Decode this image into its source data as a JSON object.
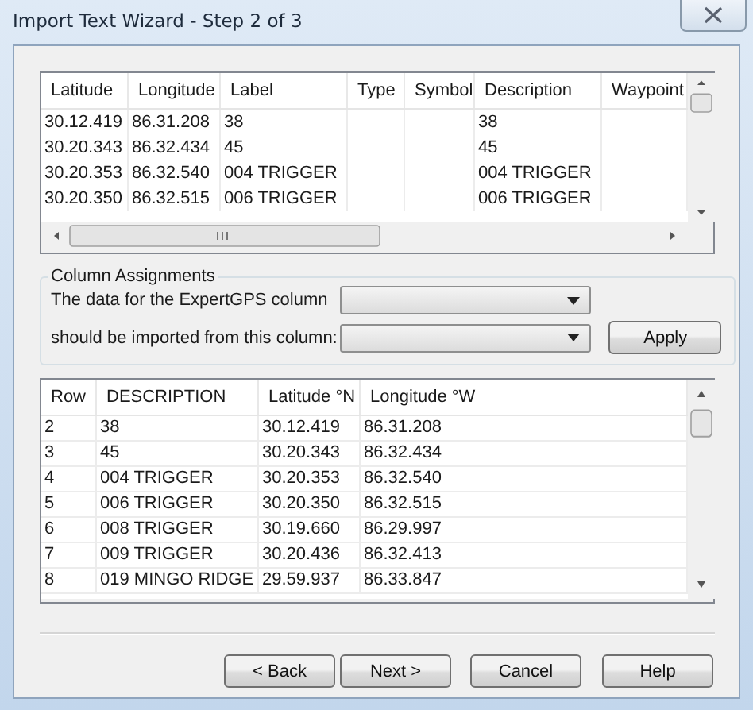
{
  "window": {
    "title": "Import Text Wizard - Step 2 of 3"
  },
  "preview_table": {
    "columns": [
      "Latitude",
      "Longitude",
      "Label",
      "Type",
      "Symbol",
      "Description",
      "Waypoint"
    ],
    "rows": [
      {
        "latitude": "30.12.419",
        "longitude": "86.31.208",
        "label": "38",
        "description": "38"
      },
      {
        "latitude": "30.20.343",
        "longitude": "86.32.434",
        "label": "45",
        "description": "45"
      },
      {
        "latitude": "30.20.353",
        "longitude": "86.32.540",
        "label": "004 TRIGGER",
        "description": "004 TRIGGER"
      },
      {
        "latitude": "30.20.350",
        "longitude": "86.32.515",
        "label": "006 TRIGGER",
        "description": "006 TRIGGER"
      }
    ]
  },
  "column_assignments": {
    "title": "Column Assignments",
    "rows": [
      {
        "label": "The data for the ExpertGPS column"
      },
      {
        "label": "should be imported from this column:"
      }
    ],
    "apply_button": "Apply"
  },
  "result_table": {
    "columns": [
      "Row",
      "DESCRIPTION",
      "Latitude °N",
      "Longitude °W"
    ],
    "rows": [
      [
        "2",
        "38",
        "30.12.419",
        "86.31.208"
      ],
      [
        "3",
        "45",
        "30.20.343",
        "86.32.434"
      ],
      [
        "4",
        "004 TRIGGER",
        "30.20.353",
        "86.32.540"
      ],
      [
        "5",
        "006 TRIGGER",
        "30.20.350",
        "86.32.515"
      ],
      [
        "6",
        "008 TRIGGER",
        "30.19.660",
        "86.29.997"
      ],
      [
        "7",
        "009 TRIGGER",
        "30.20.436",
        "86.32.413"
      ],
      [
        "8",
        "019 MINGO RIDGE",
        "29.59.937",
        "86.33.847"
      ]
    ]
  },
  "buttons": [
    {
      "label": "< Back"
    },
    {
      "label": "Next >"
    },
    {
      "label": "Cancel"
    },
    {
      "label": "Help"
    }
  ]
}
